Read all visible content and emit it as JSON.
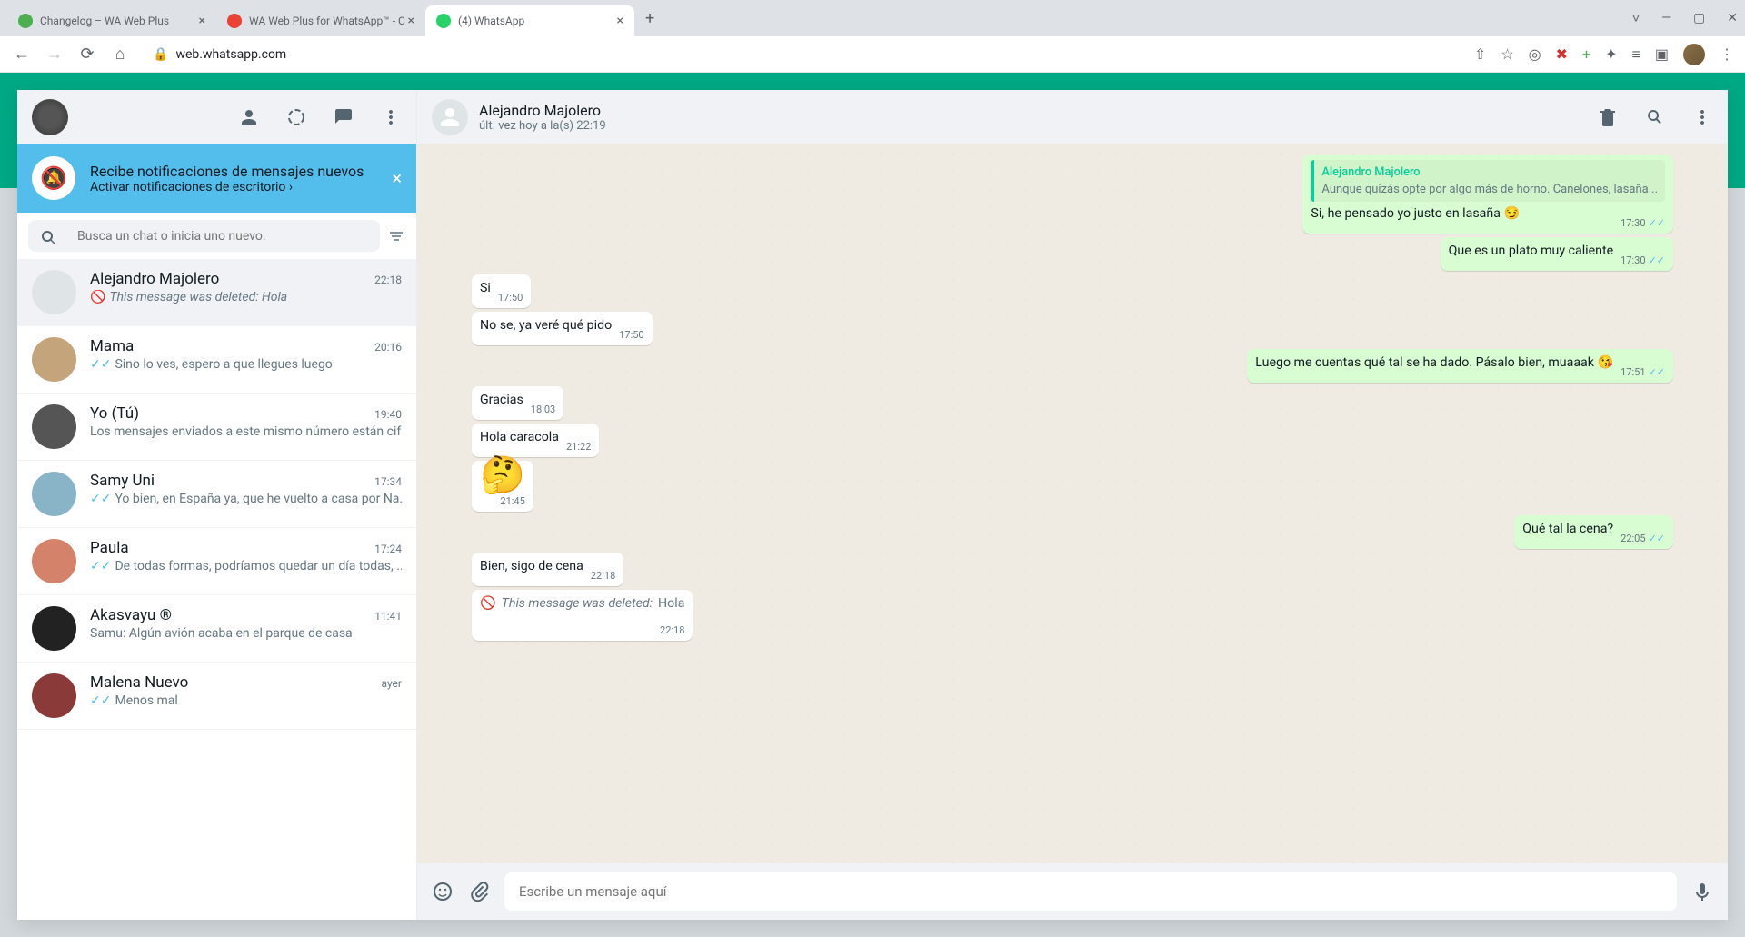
{
  "browser": {
    "tabs": [
      {
        "title": "Changelog – WA Web Plus",
        "active": false
      },
      {
        "title": "WA Web Plus for WhatsApp™ - C",
        "active": false
      },
      {
        "title": "(4) WhatsApp",
        "active": true
      }
    ],
    "url": "web.whatsapp.com"
  },
  "sidebar": {
    "notification": {
      "title": "Recibe notificaciones de mensajes nuevos",
      "link": "Activar notificaciones de escritorio ›"
    },
    "search_placeholder": "Busca un chat o inicia uno nuevo.",
    "chats": [
      {
        "name": "Alejandro Majolero",
        "time": "22:18",
        "preview": "This message was deleted: Hola",
        "type": "deleted",
        "active": true
      },
      {
        "name": "Mama",
        "time": "20:16",
        "preview": "Sino lo ves, espero a que llegues luego",
        "type": "read"
      },
      {
        "name": "Yo (Tú)",
        "time": "19:40",
        "preview": "Los mensajes enviados a este mismo número están cif...",
        "type": "plain"
      },
      {
        "name": "Samy  Uni",
        "time": "17:34",
        "preview": "Yo bien, en España ya, que he vuelto a casa por Na...",
        "type": "read"
      },
      {
        "name": "Paula",
        "time": "17:24",
        "preview": "De todas formas, podríamos quedar un día todas, ...",
        "type": "read"
      },
      {
        "name": "Akasvayu ®",
        "time": "11:41",
        "preview": "Samu: Algún avión acaba en el parque de casa",
        "type": "plain"
      },
      {
        "name": "Malena Nuevo",
        "time": "ayer",
        "preview": "Menos mal",
        "type": "read"
      }
    ]
  },
  "conversation": {
    "name": "Alejandro Majolero",
    "status": "últ. vez hoy a la(s) 22:19",
    "messages": [
      {
        "dir": "out",
        "type": "quote",
        "quote_name": "Alejandro Majolero",
        "quote_text": "Aunque quizás opte por algo más de horno. Canelones, lasaña...",
        "text": "Si, he pensado yo justo en lasaña 😏",
        "time": "17:30",
        "read": true
      },
      {
        "dir": "out",
        "type": "text",
        "text": "Que es un plato muy caliente",
        "time": "17:30",
        "read": true
      },
      {
        "dir": "in",
        "type": "text",
        "text": "Si",
        "time": "17:50"
      },
      {
        "dir": "in",
        "type": "text",
        "text": "No se, ya veré qué pido",
        "time": "17:50"
      },
      {
        "dir": "out",
        "type": "text",
        "text": "Luego me cuentas qué tal se ha dado. Pásalo bien, muaaak 😘",
        "time": "17:51",
        "read": true
      },
      {
        "dir": "in",
        "type": "text",
        "text": "Gracias",
        "time": "18:03"
      },
      {
        "dir": "in",
        "type": "text",
        "text": "Hola caracola",
        "time": "21:22"
      },
      {
        "dir": "in",
        "type": "emoji",
        "text": "🤔",
        "time": "21:45"
      },
      {
        "dir": "out",
        "type": "text",
        "text": "Qué tal la cena?",
        "time": "22:05",
        "read": true
      },
      {
        "dir": "in",
        "type": "text",
        "text": "Bien, sigo de cena",
        "time": "22:18"
      },
      {
        "dir": "in",
        "type": "deleted",
        "text": "This message was deleted: ",
        "extra": "Hola",
        "time": "22:18"
      }
    ],
    "composer_placeholder": "Escribe un mensaje aquí"
  }
}
